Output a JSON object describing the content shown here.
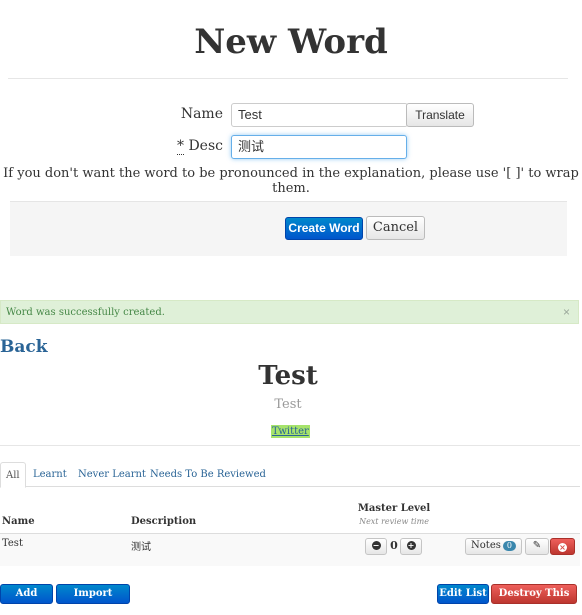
{
  "page": {
    "title": "New Word"
  },
  "form": {
    "name_label": "Name",
    "name_value": "Test",
    "translate_label": "Translate",
    "desc_required_mark": "*",
    "desc_label": "Desc",
    "desc_value": "测试",
    "hint": "If you don't want the word to be pronounced in the explanation, please use '[ ]' to wrap them.",
    "create_label": "Create Word",
    "cancel_label": "Cancel"
  },
  "alert": {
    "message": "Word was successfully created.",
    "close": "×"
  },
  "back_link": "Back",
  "word": {
    "name": "Test",
    "description": "Test",
    "tag": "Twitter"
  },
  "tabs": [
    {
      "label": "All",
      "active": true
    },
    {
      "label": "Learnt"
    },
    {
      "label": "Never Learnt"
    },
    {
      "label": "Needs To Be Reviewed"
    }
  ],
  "table": {
    "headers": {
      "name": "Name",
      "description": "Description",
      "master_level": "Master Level",
      "next_review": "Next review time"
    },
    "rows": [
      {
        "name": "Test",
        "description": "测试",
        "level": "0",
        "notes_label": "Notes",
        "notes_count": "0"
      }
    ]
  },
  "footer": {
    "add_word": "Add Word",
    "import_words": "Import Words",
    "edit_list": "Edit List",
    "destroy_list": "Destroy This List"
  },
  "colors": {
    "primary": "#0074cc",
    "danger": "#da4f49",
    "success_bg": "#dff0d8",
    "link": "#2a6496"
  }
}
